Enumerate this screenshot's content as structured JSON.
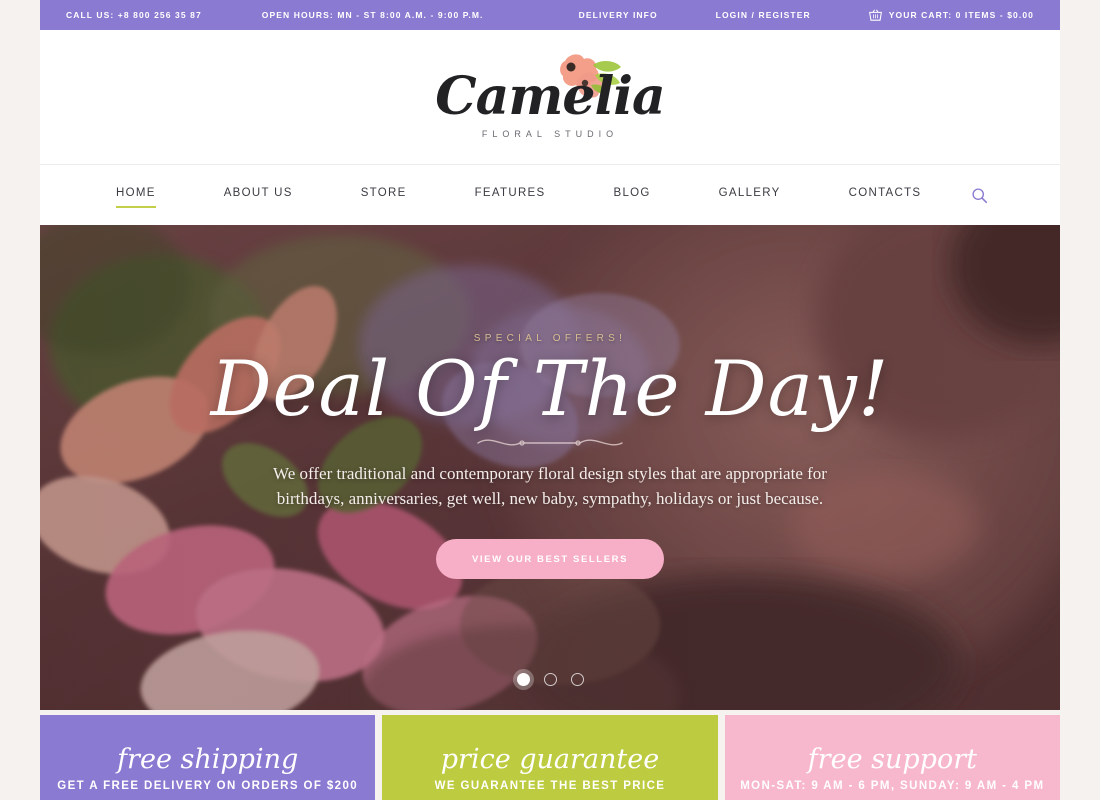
{
  "topbar": {
    "background": "#8B7AD1",
    "phone_label": "CALL US: +8 800 256 35 87",
    "hours_label": "OPEN HOURS: MN - ST 8:00 A.M. - 9:00 P.M.",
    "delivery_label": "DELIVERY INFO",
    "login_label": "LOGIN / REGISTER",
    "cart_label": "YOUR CART:  0 ITEMS - $0.00",
    "cart_icon": "basket-icon"
  },
  "logo": {
    "name": "Camelia",
    "tagline": "FLORAL STUDIO",
    "graphic": "watercolor-flowers"
  },
  "nav": {
    "items": [
      {
        "label": "HOME",
        "active": true
      },
      {
        "label": "ABOUT US",
        "active": false
      },
      {
        "label": "STORE",
        "active": false
      },
      {
        "label": "FEATURES",
        "active": false
      },
      {
        "label": "BLOG",
        "active": false
      },
      {
        "label": "GALLERY",
        "active": false
      },
      {
        "label": "CONTACTS",
        "active": false
      }
    ],
    "search_icon": "search-icon",
    "active_underline_color": "#C3CF4B"
  },
  "hero": {
    "eyebrow": "SPECIAL OFFERS!",
    "title": "Deal Of The Day!",
    "body": "We offer traditional and contemporary floral design styles that are appropriate for birthdays, anniversaries, get well, new baby, sympathy, holidays or just because.",
    "cta_label": "VIEW OUR BEST SELLERS",
    "cta_color": "#F6AFC7",
    "eyebrow_color": "#D8BE92",
    "slides_total": 3,
    "slide_active": 1
  },
  "features": [
    {
      "title": "free shipping",
      "subtitle": "GET A FREE DELIVERY ON ORDERS OF $200",
      "color": "#8B7AD1"
    },
    {
      "title": "price guarantee",
      "subtitle": "WE GUARANTEE THE BEST PRICE",
      "color": "#BCCB3F"
    },
    {
      "title": "free support",
      "subtitle": "MON-SAT: 9 AM - 6 PM, SUNDAY: 9 AM - 4 PM",
      "color": "#F7B8CE"
    }
  ]
}
